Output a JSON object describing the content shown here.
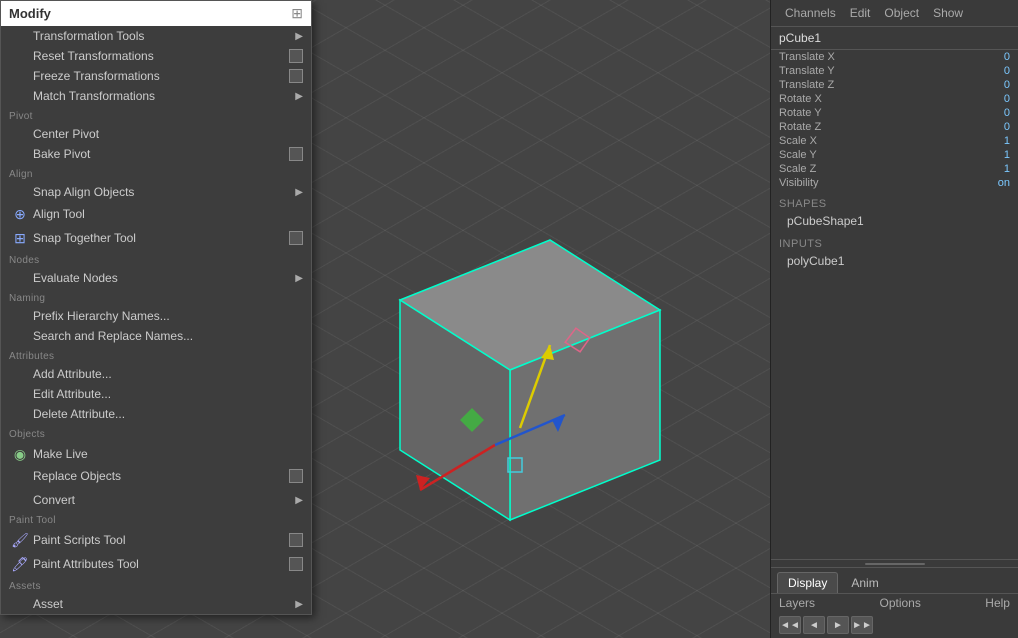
{
  "viewport": {
    "background": "#444444"
  },
  "menu": {
    "search_placeholder": "Modify",
    "sections": [
      {
        "label": null,
        "items": [
          {
            "id": "transformation-tools",
            "label": "Transformation Tools",
            "has_submenu": true,
            "icon": null
          },
          {
            "id": "reset-transformations",
            "label": "Reset Transformations",
            "has_submenu": false,
            "has_checkbox": true,
            "icon": null
          },
          {
            "id": "freeze-transformations",
            "label": "Freeze Transformations",
            "has_submenu": false,
            "has_checkbox": true,
            "icon": null
          },
          {
            "id": "match-transformations",
            "label": "Match Transformations",
            "has_submenu": true,
            "icon": null
          }
        ]
      },
      {
        "label": "Pivot",
        "items": [
          {
            "id": "center-pivot",
            "label": "Center Pivot",
            "icon": null
          },
          {
            "id": "bake-pivot",
            "label": "Bake Pivot",
            "has_checkbox": true,
            "icon": null
          }
        ]
      },
      {
        "label": "Align",
        "items": [
          {
            "id": "snap-align-objects",
            "label": "Snap Align Objects",
            "has_submenu": true,
            "icon": null
          },
          {
            "id": "align-tool",
            "label": "Align Tool",
            "icon": "align-icon"
          },
          {
            "id": "snap-together-tool",
            "label": "Snap Together Tool",
            "has_checkbox": true,
            "icon": "snap-icon"
          }
        ]
      },
      {
        "label": "Nodes",
        "items": [
          {
            "id": "evaluate-nodes",
            "label": "Evaluate Nodes",
            "has_submenu": true,
            "icon": null
          }
        ]
      },
      {
        "label": "Naming",
        "items": [
          {
            "id": "prefix-hierarchy-names",
            "label": "Prefix Hierarchy Names...",
            "icon": null
          },
          {
            "id": "search-replace-names",
            "label": "Search and Replace Names...",
            "icon": null
          }
        ]
      },
      {
        "label": "Attributes",
        "items": [
          {
            "id": "add-attribute",
            "label": "Add Attribute...",
            "icon": null
          },
          {
            "id": "edit-attribute",
            "label": "Edit Attribute...",
            "icon": null
          },
          {
            "id": "delete-attribute",
            "label": "Delete Attribute...",
            "icon": null
          }
        ]
      },
      {
        "label": "Objects",
        "items": [
          {
            "id": "make-live",
            "label": "Make Live",
            "icon": "live-icon"
          },
          {
            "id": "replace-objects",
            "label": "Replace Objects",
            "has_checkbox": true,
            "icon": null
          }
        ]
      },
      {
        "label": null,
        "items": [
          {
            "id": "convert",
            "label": "Convert",
            "has_submenu": true,
            "icon": null
          }
        ]
      },
      {
        "label": "Paint Tool",
        "items": [
          {
            "id": "paint-scripts-tool",
            "label": "Paint Scripts Tool",
            "has_checkbox": true,
            "icon": "paint-scripts-icon"
          },
          {
            "id": "paint-attributes-tool",
            "label": "Paint Attributes Tool",
            "has_checkbox": true,
            "icon": "paint-attr-icon"
          }
        ]
      },
      {
        "label": "Assets",
        "items": [
          {
            "id": "asset",
            "label": "Asset",
            "has_submenu": true,
            "icon": null
          }
        ]
      }
    ]
  },
  "right_panel": {
    "header_buttons": [
      "Channels",
      "Edit",
      "Object",
      "Show"
    ],
    "object_name": "pCube1",
    "channels": [
      {
        "label": "Translate X",
        "value": "0"
      },
      {
        "label": "Translate Y",
        "value": "0"
      },
      {
        "label": "Translate Z",
        "value": "0"
      },
      {
        "label": "Rotate X",
        "value": "0"
      },
      {
        "label": "Rotate Y",
        "value": "0"
      },
      {
        "label": "Rotate Z",
        "value": "0"
      },
      {
        "label": "Scale X",
        "value": "1"
      },
      {
        "label": "Scale Y",
        "value": "1"
      },
      {
        "label": "Scale Z",
        "value": "1"
      },
      {
        "label": "Visibility",
        "value": "on"
      }
    ],
    "shapes_label": "SHAPES",
    "shapes": [
      "pCubeShape1"
    ],
    "inputs_label": "INPUTS",
    "inputs": [
      "polyCube1"
    ],
    "bottom_tabs": [
      "Display",
      "Anim"
    ],
    "active_tab": "Display",
    "bottom_menu_items": [
      "Layers",
      "Options",
      "Help"
    ],
    "nav_arrows": [
      "◄◄",
      "◄",
      "►",
      "►►"
    ]
  }
}
